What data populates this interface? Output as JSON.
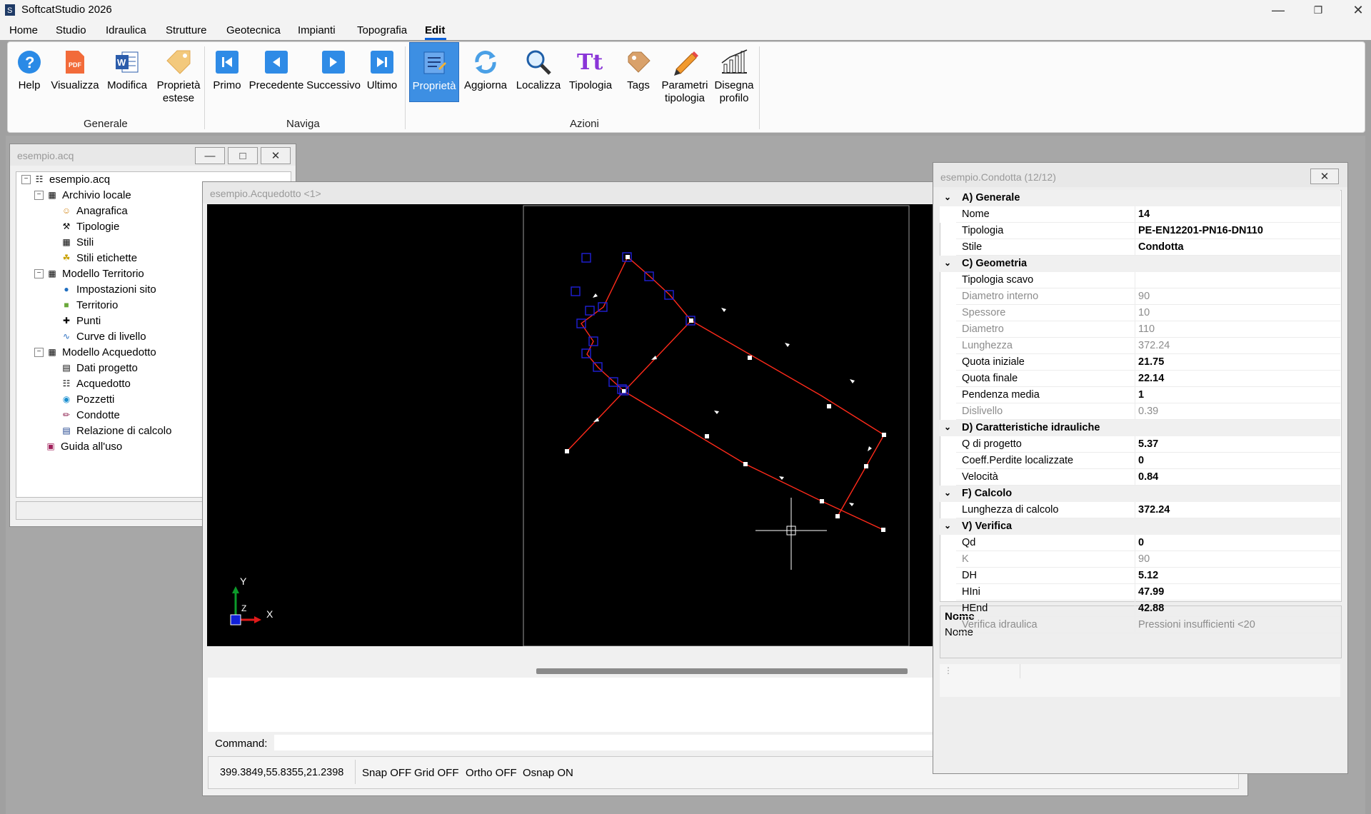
{
  "app": {
    "title": "SoftcatStudio 2026"
  },
  "menu": [
    "Home",
    "Studio",
    "Idraulica",
    "Strutture",
    "Geotecnica",
    "Impianti",
    "Topografia",
    "Edit"
  ],
  "ribbon": {
    "buttons": {
      "help": "Help",
      "visualizza": "Visualizza",
      "modifica": "Modifica",
      "proprieta_estese": "Proprietà estese",
      "primo": "Primo",
      "precedente": "Precedente",
      "successivo": "Successivo",
      "ultimo": "Ultimo",
      "proprieta": "Proprietà",
      "aggiorna": "Aggiorna",
      "localizza": "Localizza",
      "tipologia": "Tipologia",
      "tags": "Tags",
      "parametri_tipologia": "Parametri tipologia",
      "disegna_profilo": "Disegna profilo"
    },
    "groups": {
      "generale": "Generale",
      "naviga": "Naviga",
      "azioni": "Azioni"
    },
    "icons": {
      "help": "help-icon",
      "pdf": "pdf-icon",
      "word": "word-icon",
      "tag": "tag-icon",
      "first": "first-icon",
      "prev": "previous-icon",
      "next": "next-icon",
      "last": "last-icon",
      "properties": "properties-icon",
      "refresh": "refresh-icon",
      "search": "magnifier-icon",
      "type": "type-icon",
      "pencil": "pencil-icon",
      "profile": "profile-chart-icon"
    }
  },
  "tree_window": {
    "title": "esempio.acq"
  },
  "tree": {
    "root": "esempio.acq",
    "archivio": "Archivio locale",
    "anagrafica": "Anagrafica",
    "tipologie": "Tipologie",
    "stili": "Stili",
    "stili_etichette": "Stili etichette",
    "modello_territorio": "Modello Territorio",
    "impostazioni_sito": "Impostazioni sito",
    "territorio": "Territorio",
    "punti": "Punti",
    "curve_livello": "Curve di livello",
    "modello_acquedotto": "Modello Acquedotto",
    "dati_progetto": "Dati progetto",
    "acquedotto": "Acquedotto",
    "pozzetti": "Pozzetti",
    "condotte": "Condotte",
    "relazione": "Relazione di calcolo",
    "guida": "Guida all'uso"
  },
  "cad_window": {
    "title": "esempio.Acquedotto <1>",
    "command_label": "Command:",
    "coords": "399.3849,55.8355,21.2398",
    "snap": "Snap OFF",
    "grid": "Grid OFF",
    "ortho": "Ortho OFF",
    "osnap": "Osnap ON",
    "axis_y": "Y",
    "axis_x": "X",
    "axis_z": "Z"
  },
  "prop_window": {
    "title": "esempio.Condotta (12/12)",
    "desc_title": "Nome",
    "desc_text": "Nome"
  },
  "properties": {
    "cat_a": "A) Generale",
    "nome": {
      "label": "Nome",
      "value": "14"
    },
    "tipologia": {
      "label": "Tipologia",
      "value": "PE-EN12201-PN16-DN110"
    },
    "stile": {
      "label": "Stile",
      "value": "Condotta"
    },
    "cat_c": "C) Geometria",
    "tipologia_scavo": {
      "label": "Tipologia scavo",
      "value": ""
    },
    "diametro_interno": {
      "label": "Diametro interno",
      "value": "90"
    },
    "spessore": {
      "label": "Spessore",
      "value": "10"
    },
    "diametro": {
      "label": "Diametro",
      "value": "110"
    },
    "lunghezza": {
      "label": "Lunghezza",
      "value": "372.24"
    },
    "quota_iniziale": {
      "label": "Quota iniziale",
      "value": "21.75"
    },
    "quota_finale": {
      "label": "Quota finale",
      "value": "22.14"
    },
    "pendenza_media": {
      "label": "Pendenza media",
      "value": "1"
    },
    "dislivello": {
      "label": "Dislivello",
      "value": "0.39"
    },
    "cat_d": "D) Caratteristiche idrauliche",
    "q_progetto": {
      "label": "Q di progetto",
      "value": "5.37"
    },
    "coeff_perdite": {
      "label": "Coeff.Perdite localizzate",
      "value": "0"
    },
    "velocita": {
      "label": "Velocità",
      "value": "0.84"
    },
    "cat_f": "F) Calcolo",
    "lunghezza_calcolo": {
      "label": "Lunghezza di calcolo",
      "value": "372.24"
    },
    "cat_v": "V) Verifica",
    "qd": {
      "label": "Qd",
      "value": "0"
    },
    "k": {
      "label": "K",
      "value": "90"
    },
    "dh": {
      "label": "DH",
      "value": "5.12"
    },
    "hini": {
      "label": "HIni",
      "value": "47.99"
    },
    "hend": {
      "label": "HEnd",
      "value": "42.88"
    },
    "verifica_idraulica": {
      "label": "Verifica idraulica",
      "value": "Pressioni insufficienti <20"
    }
  },
  "colors": {
    "accent": "#3d8fe3",
    "pipe": "#ff2a1a",
    "selection": "#1010c0",
    "canvas": "#000000"
  }
}
